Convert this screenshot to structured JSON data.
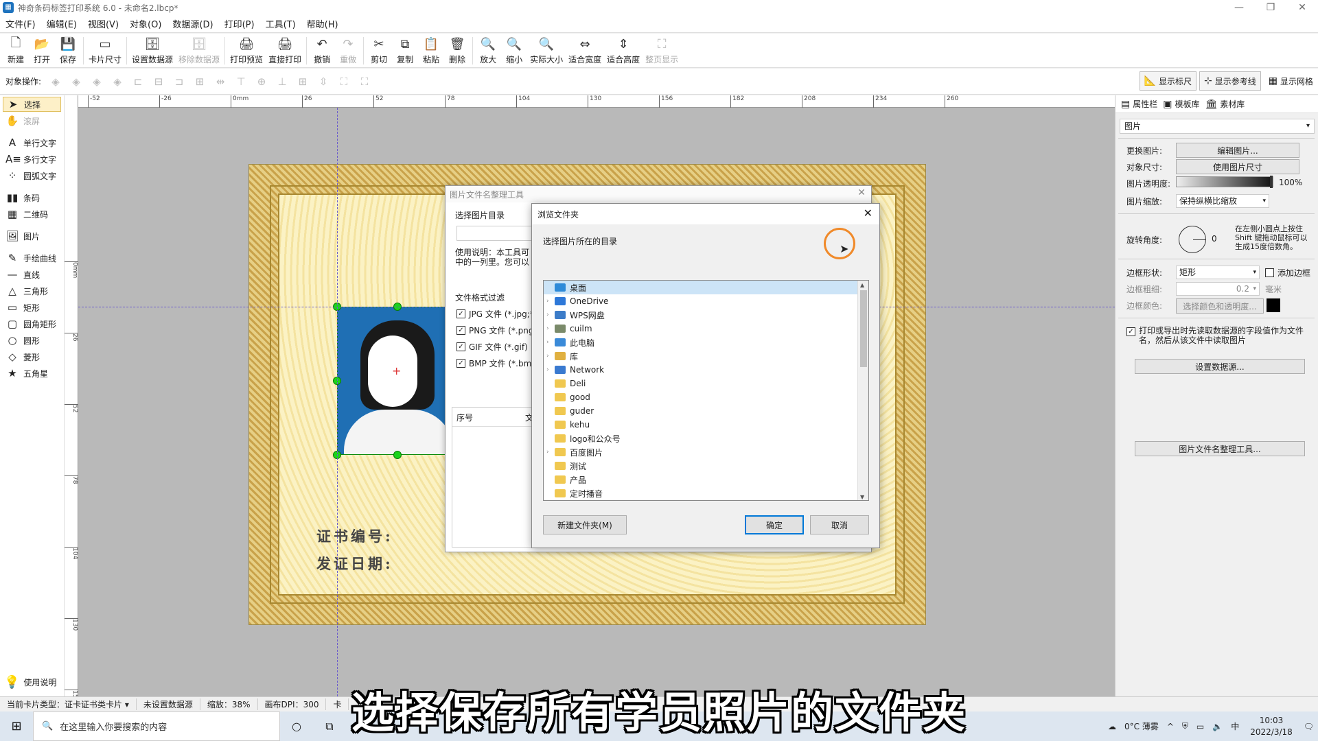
{
  "window": {
    "title": "神奇条码标签打印系统 6.0 - 未命名2.lbcp*",
    "controls": [
      "—",
      "❐",
      "✕"
    ]
  },
  "menu": [
    "文件(F)",
    "编辑(E)",
    "视图(V)",
    "对象(O)",
    "数据源(D)",
    "打印(P)",
    "工具(T)",
    "帮助(H)"
  ],
  "toolbar": [
    {
      "label": "新建",
      "icon": "🗋",
      "enabled": true
    },
    {
      "label": "打开",
      "icon": "📂",
      "enabled": true
    },
    {
      "label": "保存",
      "icon": "💾",
      "enabled": true
    },
    {
      "label": "卡片尺寸",
      "icon": "▭",
      "enabled": true
    },
    {
      "label": "设置数据源",
      "icon": "🗄",
      "enabled": true
    },
    {
      "label": "移除数据源",
      "icon": "🗄",
      "enabled": false
    },
    {
      "label": "打印预览",
      "icon": "🖨",
      "enabled": true
    },
    {
      "label": "直接打印",
      "icon": "🖨",
      "enabled": true
    },
    {
      "label": "撤销",
      "icon": "↶",
      "enabled": true
    },
    {
      "label": "重做",
      "icon": "↷",
      "enabled": false
    },
    {
      "label": "剪切",
      "icon": "✂",
      "enabled": true
    },
    {
      "label": "复制",
      "icon": "⧉",
      "enabled": true
    },
    {
      "label": "粘贴",
      "icon": "📋",
      "enabled": true
    },
    {
      "label": "删除",
      "icon": "🗑",
      "enabled": true
    },
    {
      "label": "放大",
      "icon": "🔍",
      "enabled": true
    },
    {
      "label": "缩小",
      "icon": "🔍",
      "enabled": true
    },
    {
      "label": "实际大小",
      "icon": "🔍",
      "enabled": true
    },
    {
      "label": "适合宽度",
      "icon": "⇔",
      "enabled": true
    },
    {
      "label": "适合高度",
      "icon": "⇕",
      "enabled": true
    },
    {
      "label": "整页显示",
      "icon": "⛶",
      "enabled": false
    }
  ],
  "toolbar2": {
    "label": "对象操作:",
    "toggles": [
      "显示标尺",
      "显示参考线",
      "显示网格"
    ]
  },
  "leftpanel": {
    "items": [
      {
        "label": "选择",
        "icon": "➤",
        "state": "selected"
      },
      {
        "label": "滚屏",
        "icon": "✋",
        "state": "disabled"
      },
      {
        "label": "单行文字",
        "icon": "A",
        "state": "normal"
      },
      {
        "label": "多行文字",
        "icon": "A≡",
        "state": "normal"
      },
      {
        "label": "圆弧文字",
        "icon": "⁘",
        "state": "normal"
      },
      {
        "label": "条码",
        "icon": "▮▮",
        "state": "normal"
      },
      {
        "label": "二维码",
        "icon": "▦",
        "state": "normal"
      },
      {
        "label": "图片",
        "icon": "🖼",
        "state": "normal"
      },
      {
        "label": "手绘曲线",
        "icon": "✎",
        "state": "normal"
      },
      {
        "label": "直线",
        "icon": "—",
        "state": "normal"
      },
      {
        "label": "三角形",
        "icon": "△",
        "state": "normal"
      },
      {
        "label": "矩形",
        "icon": "▭",
        "state": "normal"
      },
      {
        "label": "圆角矩形",
        "icon": "▢",
        "state": "normal"
      },
      {
        "label": "圆形",
        "icon": "○",
        "state": "normal"
      },
      {
        "label": "菱形",
        "icon": "◇",
        "state": "normal"
      },
      {
        "label": "五角星",
        "icon": "★",
        "state": "normal"
      }
    ],
    "help": "使用说明"
  },
  "ruler_h": [
    "-52",
    "-26",
    "0mm",
    "26",
    "52",
    "78",
    "104",
    "130",
    "156",
    "182",
    "208",
    "234",
    "260"
  ],
  "ruler_v": [
    "0mm",
    "26",
    "52",
    "78",
    "104",
    "130",
    "156"
  ],
  "card": {
    "cert_no": "证书编号:",
    "issue_date": "发证日期:"
  },
  "dlg_tool": {
    "title": "图片文件名整理工具",
    "dir_label": "选择图片目录",
    "usage": "使用说明：本工具可",
    "usage2": "中的一列里。您可以",
    "filter_label": "文件格式过滤",
    "filters": [
      "JPG 文件 (*.jpg;*",
      "PNG 文件 (*.png",
      "GIF 文件 (*.gif)",
      "BMP 文件 (*.bmp"
    ],
    "col_no": "序号",
    "col_file": "文"
  },
  "dlg_browse": {
    "title": "浏览文件夹",
    "prompt": "选择图片所在的目录",
    "tree": [
      {
        "label": "桌面",
        "level": 0,
        "expand": false,
        "color": "#2e8ad8",
        "selected": true
      },
      {
        "label": "OneDrive",
        "level": 1,
        "expand": true,
        "color": "#2e78d8",
        "selected": false
      },
      {
        "label": "WPS网盘",
        "level": 1,
        "expand": true,
        "color": "#3c7cc8",
        "selected": false
      },
      {
        "label": "cuilm",
        "level": 1,
        "expand": true,
        "color": "#7a8a6a",
        "selected": false
      },
      {
        "label": "此电脑",
        "level": 1,
        "expand": true,
        "color": "#3a8ad8",
        "selected": false
      },
      {
        "label": "库",
        "level": 1,
        "expand": true,
        "color": "#e0b040",
        "selected": false
      },
      {
        "label": "Network",
        "level": 1,
        "expand": true,
        "color": "#3a7ad0",
        "selected": false
      },
      {
        "label": "Deli",
        "level": 1,
        "expand": false,
        "color": "#f0c850",
        "selected": false
      },
      {
        "label": "good",
        "level": 1,
        "expand": false,
        "color": "#f0c850",
        "selected": false
      },
      {
        "label": "guder",
        "level": 1,
        "expand": false,
        "color": "#f0c850",
        "selected": false
      },
      {
        "label": "kehu",
        "level": 1,
        "expand": false,
        "color": "#f0c850",
        "selected": false
      },
      {
        "label": "logo和公众号",
        "level": 1,
        "expand": false,
        "color": "#f0c850",
        "selected": false
      },
      {
        "label": "百度图片",
        "level": 1,
        "expand": true,
        "color": "#f0c850",
        "selected": false
      },
      {
        "label": "测试",
        "level": 1,
        "expand": false,
        "color": "#f0c850",
        "selected": false
      },
      {
        "label": "产品",
        "level": 1,
        "expand": false,
        "color": "#f0c850",
        "selected": false
      },
      {
        "label": "定时播音",
        "level": 1,
        "expand": false,
        "color": "#f0c850",
        "selected": false
      }
    ],
    "new_folder": "新建文件夹(M)",
    "ok": "确定",
    "cancel": "取消"
  },
  "rightpanel": {
    "tabs": [
      "属性栏",
      "模板库",
      "素材库"
    ],
    "object_type": "图片",
    "change_image": "更换图片:",
    "edit_image": "编辑图片...",
    "obj_size": "对象尺寸:",
    "use_image_size": "使用图片尺寸",
    "opacity_label": "图片透明度:",
    "opacity_value": "100%",
    "opacity": 1.0,
    "scale_label": "图片缩放:",
    "scale_value": "保持纵横比缩放",
    "rotate_label": "旋转角度:",
    "rotate_value": "0",
    "rotate_hint": "在左侧小圆点上按住Shift 键拖动鼠标可以生成15度倍数角。",
    "border_shape_label": "边框形状:",
    "border_shape": "矩形",
    "add_border": "添加边框",
    "border_width_label": "边框粗细:",
    "border_width": "0.2",
    "border_unit": "毫米",
    "border_color_label": "边框颜色:",
    "border_color_btn": "选择颜色和透明度...",
    "print_note": "打印或导出时先读取数据源的字段值作为文件名，然后从该文件中读取图片",
    "set_datasource": "设置数据源...",
    "rename_tool": "图片文件名整理工具..."
  },
  "statusbar": [
    "当前卡片类型：证卡证书类卡片 ▾",
    "未设置数据源",
    "缩放：38%",
    "画布DPI：300",
    "卡"
  ],
  "taskbar": {
    "search": "在这里输入你要搜索的内容",
    "weather": "0°C 薄雾",
    "time": "10:03",
    "date": "2022/3/18"
  },
  "subtitle": "选择保存所有学员照片的文件夹"
}
